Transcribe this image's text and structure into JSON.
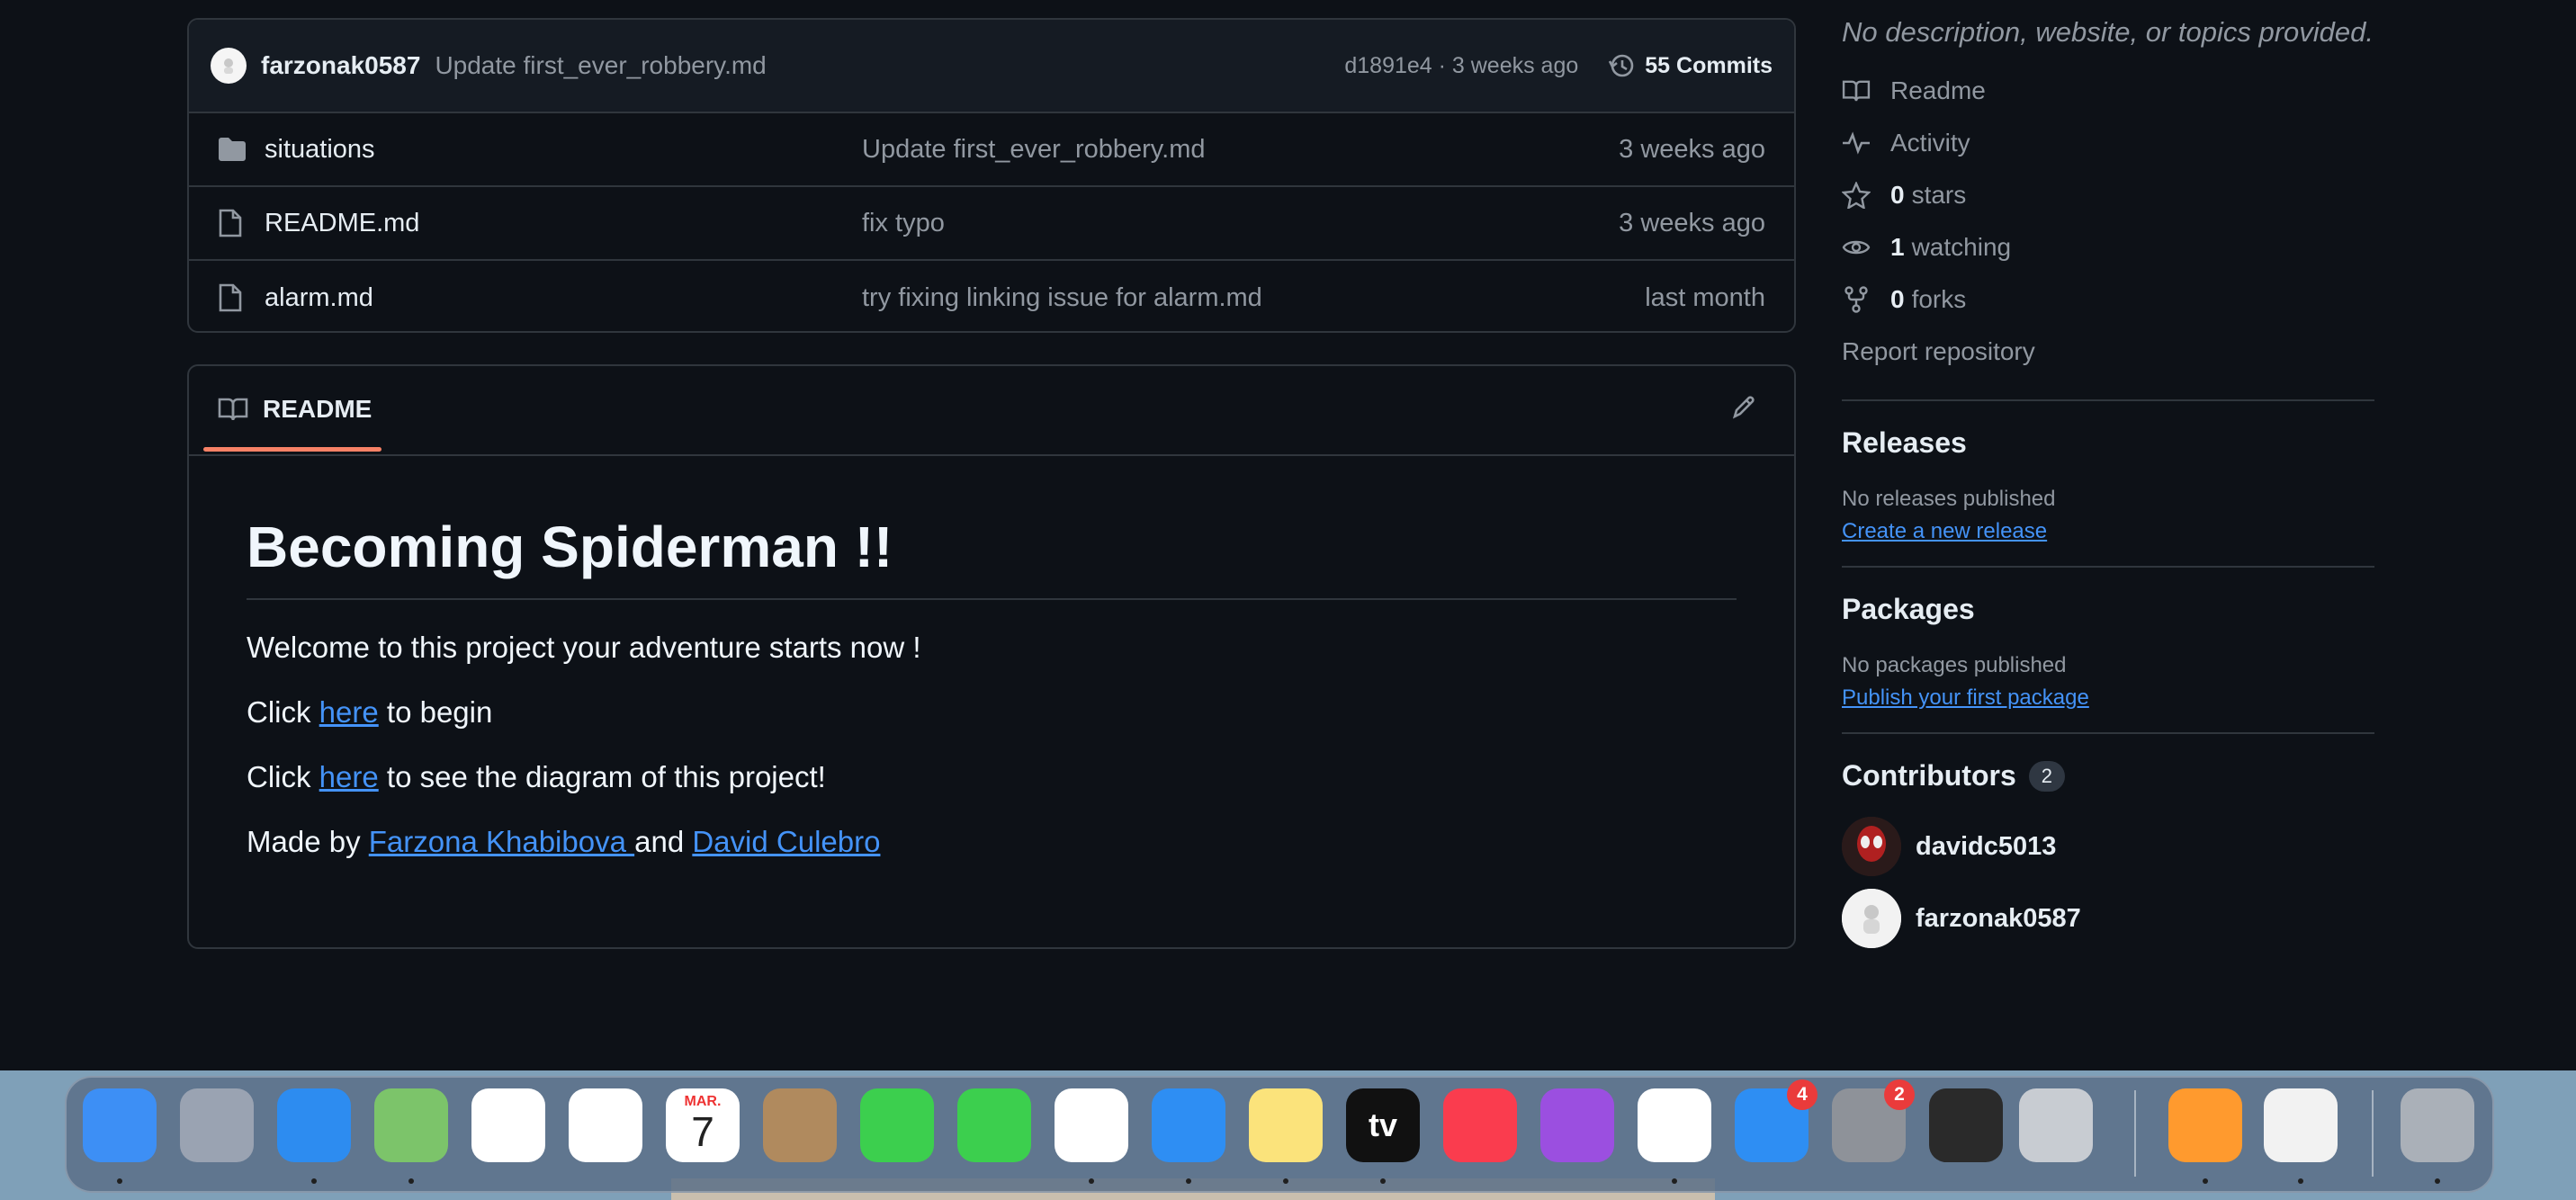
{
  "latest_commit": {
    "author": "farzonak0587",
    "message": "Update first_ever_robbery.md",
    "hash_time": "d1891e4 · 3 weeks ago",
    "commits_label": "55 Commits"
  },
  "files": [
    {
      "name": "situations",
      "type": "folder",
      "message": "Update first_ever_robbery.md",
      "age": "3 weeks ago"
    },
    {
      "name": "README.md",
      "type": "file",
      "message": "fix typo",
      "age": "3 weeks ago"
    },
    {
      "name": "alarm.md",
      "type": "file",
      "message": "try fixing linking issue for alarm.md",
      "age": "last month"
    }
  ],
  "readme": {
    "tab_label": "README",
    "title": "Becoming Spiderman !!",
    "welcome": "Welcome to this project your adventure starts now !",
    "line1": {
      "prefix": "Click ",
      "link": "here",
      "suffix": " to begin"
    },
    "line2": {
      "prefix": "Click ",
      "link": "here",
      "suffix": " to see the diagram of this project!"
    },
    "line3": {
      "prefix": "Made by ",
      "link1": "Farzona Khabibova ",
      "mid": "and ",
      "link2": "David Culebro"
    }
  },
  "sidebar": {
    "description": "No description, website, or topics provided.",
    "readme_label": "Readme",
    "activity_label": "Activity",
    "stars": {
      "count": "0",
      "label": "stars"
    },
    "watching": {
      "count": "1",
      "label": "watching"
    },
    "forks": {
      "count": "0",
      "label": "forks"
    },
    "report_label": "Report repository",
    "releases": {
      "heading": "Releases",
      "note": "No releases published",
      "link": "Create a new release"
    },
    "packages": {
      "heading": "Packages",
      "note": "No packages published",
      "link": "Publish your first package"
    },
    "contributors": {
      "heading": "Contributors",
      "count": "2",
      "users": [
        "davidc5013",
        "farzonak0587"
      ]
    }
  },
  "dock": {
    "apps": [
      {
        "name": "finder-icon",
        "color": "#3d8ff5"
      },
      {
        "name": "launchpad-icon",
        "color": "#9aa3b2"
      },
      {
        "name": "mail-icon",
        "color": "#2d8cf0"
      },
      {
        "name": "maps-icon",
        "color": "#7cc46a"
      },
      {
        "name": "reminders-icon",
        "color": "#ffffff"
      },
      {
        "name": "photos-icon",
        "color": "#ffffff"
      },
      {
        "name": "calendar-icon",
        "color": "#ffffff"
      },
      {
        "name": "contacts-icon",
        "color": "#b08a5e"
      },
      {
        "name": "facetime-icon",
        "color": "#3ccf4e"
      },
      {
        "name": "messages-icon",
        "color": "#3ccf4e"
      },
      {
        "name": "chrome-icon",
        "color": "#ffffff"
      },
      {
        "name": "safari-icon",
        "color": "#2e8ef3"
      },
      {
        "name": "notes-icon",
        "color": "#fbe37b"
      },
      {
        "name": "apple-tv-icon",
        "color": "#111111"
      },
      {
        "name": "music-icon",
        "color": "#fa3c4e"
      },
      {
        "name": "podcasts-icon",
        "color": "#9b4fe0"
      },
      {
        "name": "news-icon",
        "color": "#ffffff"
      },
      {
        "name": "app-store-icon",
        "color": "#2e8ef3"
      },
      {
        "name": "system-settings-icon",
        "color": "#8e9299"
      },
      {
        "name": "garageband-icon",
        "color": "#2a2a2a"
      },
      {
        "name": "roblox-icon",
        "color": "#c8ccd2"
      },
      {
        "name": "installer-icon",
        "color": "#ff9a2e"
      },
      {
        "name": "script-editor-icon",
        "color": "#f2f2f2"
      },
      {
        "name": "trash-icon",
        "color": "#aab0b8"
      }
    ],
    "calendar": {
      "month": "MAR.",
      "day": "7"
    },
    "app_store_badge": "4",
    "settings_badge": "2",
    "tv_label": "tv"
  }
}
